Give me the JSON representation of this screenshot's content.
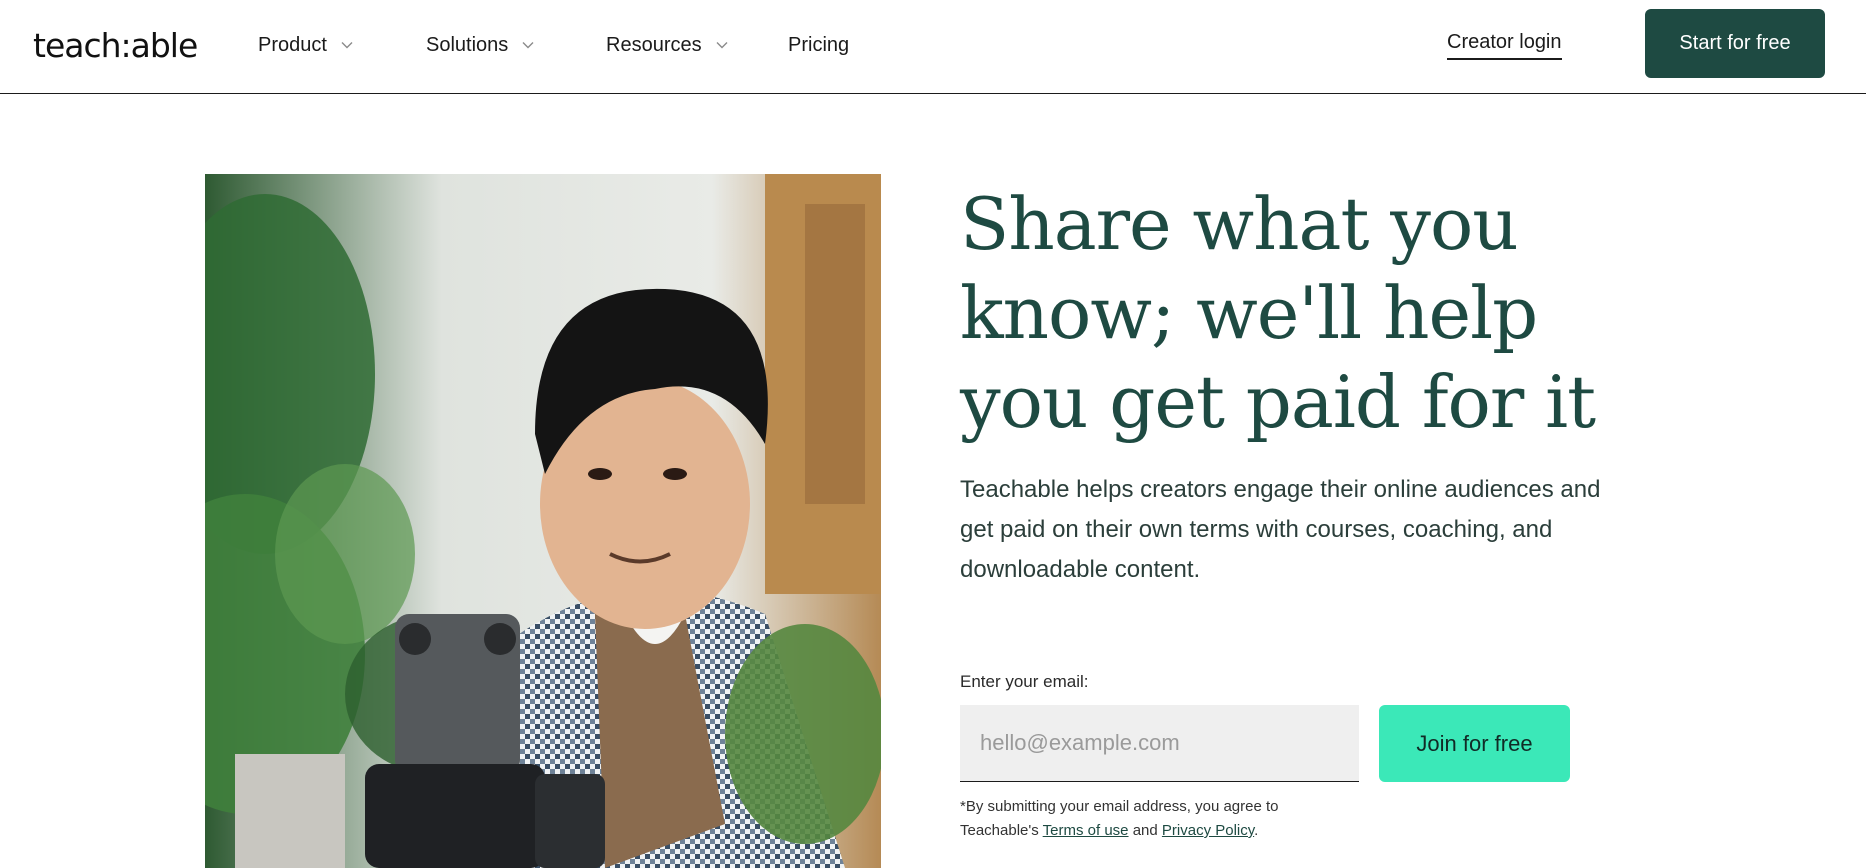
{
  "brand": {
    "logo_text": "teach:able",
    "primary_color": "#1e4a42",
    "accent_color": "#3be8b8"
  },
  "nav": {
    "items": [
      {
        "label": "Product",
        "has_dropdown": true,
        "icon": "chevron-down-icon"
      },
      {
        "label": "Solutions",
        "has_dropdown": true,
        "icon": "chevron-down-icon"
      },
      {
        "label": "Resources",
        "has_dropdown": true,
        "icon": "chevron-down-icon"
      },
      {
        "label": "Pricing",
        "has_dropdown": false
      }
    ],
    "login_label": "Creator login",
    "cta_label": "Start for free"
  },
  "hero": {
    "headline": "Share what you know; we'll help you get paid for it",
    "subheadline": "Teachable helps creators engage their online audiences and get paid on their own terms with courses, coaching, and downloadable content.",
    "form": {
      "label": "Enter your email:",
      "placeholder": "hello@example.com",
      "value": "",
      "button_label": "Join for free"
    },
    "disclaimer": {
      "prefix": "*By submitting your email address, you agree to Teachable's ",
      "terms_link": "Terms of use",
      "and_text": " and ",
      "privacy_link": "Privacy Policy",
      "suffix": "."
    }
  }
}
